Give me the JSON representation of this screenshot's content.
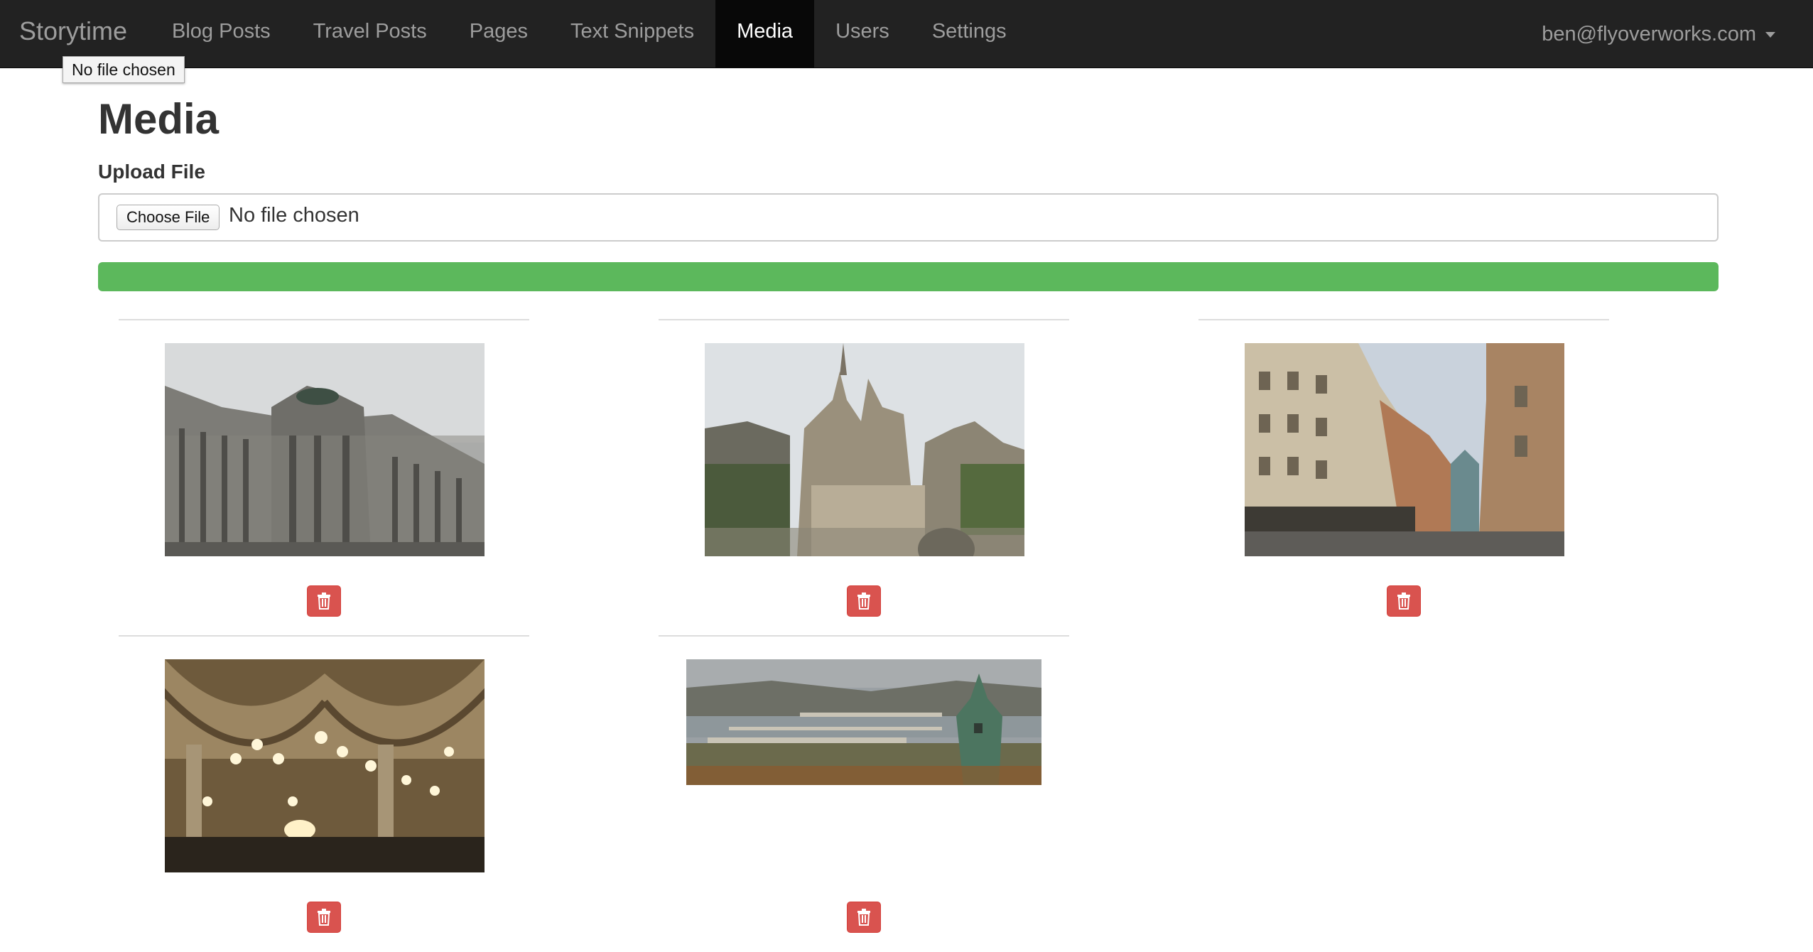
{
  "navbar": {
    "brand": "Storytime",
    "items": [
      {
        "label": "Blog Posts",
        "active": false
      },
      {
        "label": "Travel Posts",
        "active": false
      },
      {
        "label": "Pages",
        "active": false
      },
      {
        "label": "Text Snippets",
        "active": false
      },
      {
        "label": "Media",
        "active": true
      },
      {
        "label": "Users",
        "active": false
      },
      {
        "label": "Settings",
        "active": false
      }
    ],
    "user_email": "ben@flyoverworks.com"
  },
  "tooltip": "No file chosen",
  "page_title": "Media",
  "upload": {
    "label": "Upload File",
    "button_label": "Choose File",
    "status": "No file chosen",
    "progress_fraction": 1.0
  },
  "media_items": [
    {
      "subject": "neo-renaissance palace facade under overcast sky",
      "delete_icon": "trash-icon"
    },
    {
      "subject": "gothic church with spires and stone terraces",
      "delete_icon": "trash-icon"
    },
    {
      "subject": "city street lined with ornate historic buildings",
      "delete_icon": "trash-icon"
    },
    {
      "subject": "grand cafe interior with vaulted ceiling and chandeliers",
      "delete_icon": "trash-icon"
    },
    {
      "subject": "panorama of river with multiple bridges and green domed tower",
      "delete_icon": "trash-icon"
    }
  ],
  "colors": {
    "navbar_bg": "#222222",
    "nav_active_bg": "#080808",
    "nav_text": "#9d9d9d",
    "progress_green": "#5cb85c",
    "delete_red": "#d9534f"
  }
}
